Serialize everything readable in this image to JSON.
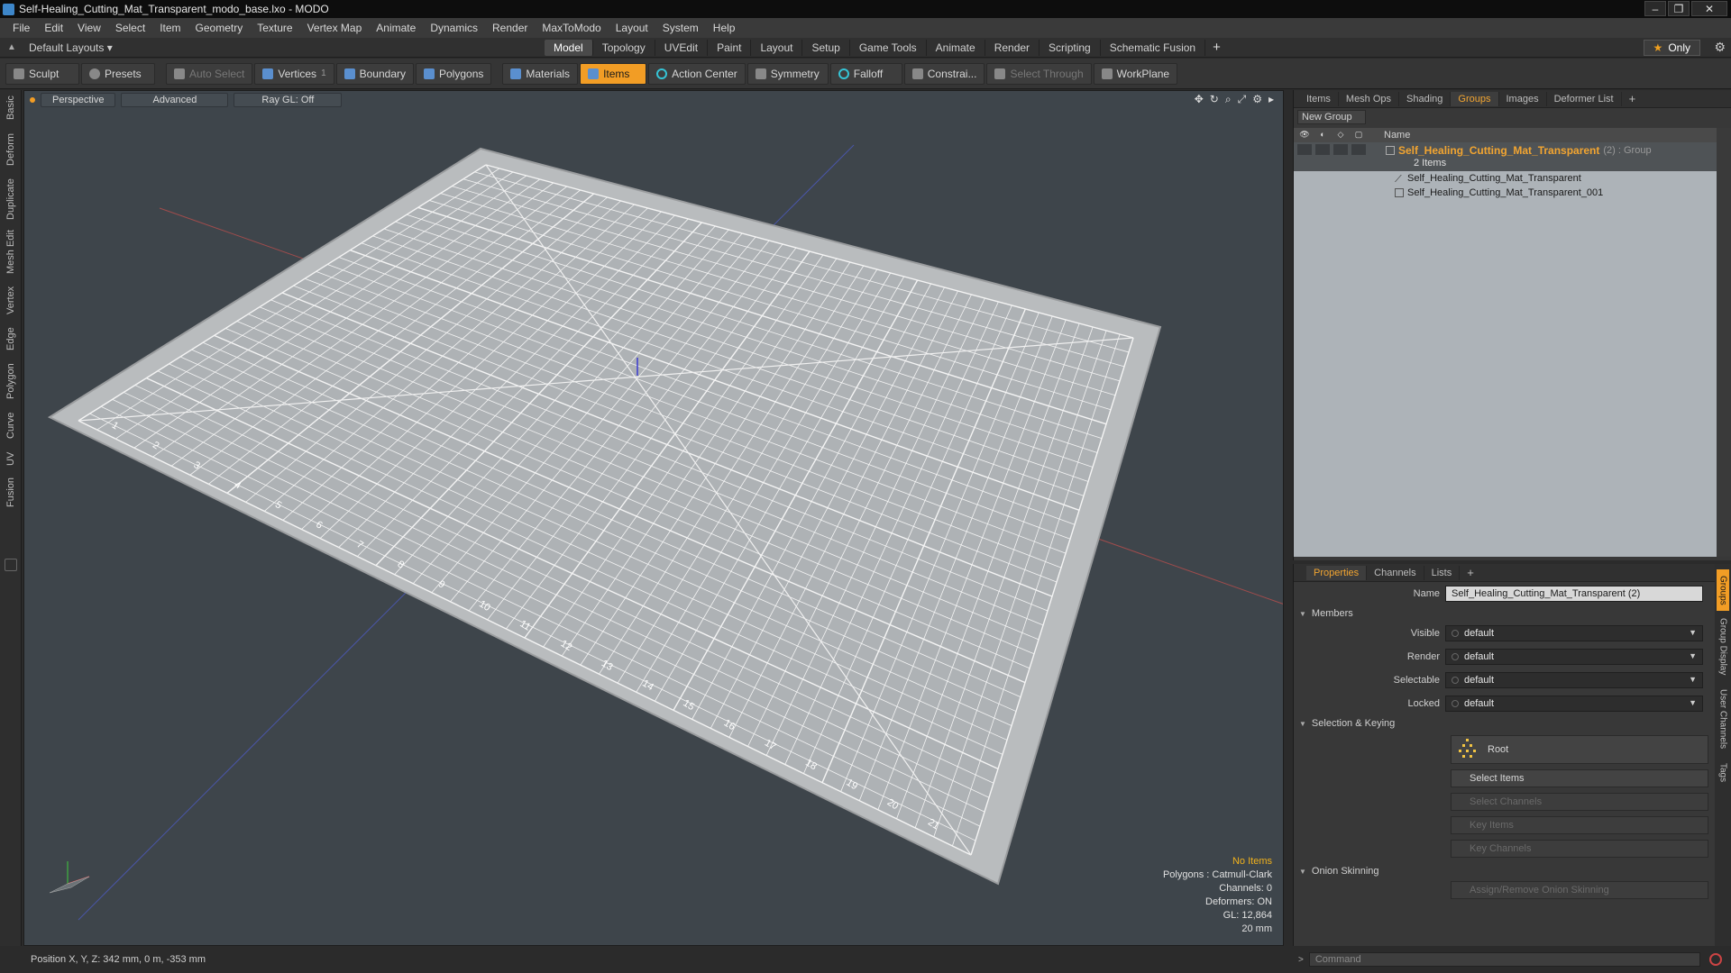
{
  "window": {
    "title": "Self-Healing_Cutting_Mat_Transparent_modo_base.lxo - MODO",
    "minimize": "–",
    "restore": "❐",
    "close": "✕"
  },
  "menu": [
    "File",
    "Edit",
    "View",
    "Select",
    "Item",
    "Geometry",
    "Texture",
    "Vertex Map",
    "Animate",
    "Dynamics",
    "Render",
    "MaxToModo",
    "Layout",
    "System",
    "Help"
  ],
  "layouts": {
    "label": "Default Layouts ▾"
  },
  "tabs": [
    "Model",
    "Topology",
    "UVEdit",
    "Paint",
    "Layout",
    "Setup",
    "Game Tools",
    "Animate",
    "Render",
    "Scripting",
    "Schematic Fusion"
  ],
  "tabs_active": "Model",
  "tabs_plus": "+",
  "only_label": "Only",
  "toolbar": {
    "sculpt": "Sculpt",
    "presets": "Presets",
    "auto_select": "Auto Select",
    "vertices": "Vertices",
    "vertices_count": "1",
    "boundary": "Boundary",
    "polygons": "Polygons",
    "materials": "Materials",
    "items": "Items",
    "action_center": "Action Center",
    "symmetry": "Symmetry",
    "falloff": "Falloff",
    "constraints": "Constrai...",
    "select_through": "Select Through",
    "workplane": "WorkPlane"
  },
  "left_tabs": [
    "Basic",
    "Deform",
    "Duplicate",
    "Mesh Edit",
    "Vertex",
    "Edge",
    "Polygon",
    "Curve",
    "UV",
    "Fusion"
  ],
  "viewport": {
    "view": "Perspective",
    "shading": "Advanced",
    "raygl": "Ray GL: Off",
    "info": {
      "selection": "No Items",
      "polygons": "Polygons : Catmull-Clark",
      "channels": "Channels: 0",
      "deformers": "Deformers: ON",
      "gl": "GL: 12,864",
      "grid": "20 mm"
    },
    "ruler_labels": [
      "1",
      "2",
      "3",
      "4",
      "5",
      "6",
      "7",
      "8",
      "9",
      "10",
      "11",
      "12",
      "13",
      "14",
      "15",
      "16",
      "17",
      "18",
      "19",
      "20",
      "21"
    ]
  },
  "status": {
    "position": "Position X, Y, Z:  342 mm, 0 m, -353 mm"
  },
  "groups_panel": {
    "tabs": [
      "Items",
      "Mesh Ops",
      "Shading",
      "Groups",
      "Images",
      "Deformer List"
    ],
    "active_tab": "Groups",
    "new_group": "New Group",
    "name_header": "Name",
    "group": {
      "name": "Self_Healing_Cutting_Mat_Transparent",
      "suffix": "(2) : Group",
      "count": "2 Items"
    },
    "items": [
      "Self_Healing_Cutting_Mat_Transparent",
      "Self_Healing_Cutting_Mat_Transparent_001"
    ]
  },
  "properties": {
    "tabs": [
      "Properties",
      "Channels",
      "Lists"
    ],
    "active_tab": "Properties",
    "name_label": "Name",
    "name_value": "Self_Healing_Cutting_Mat_Transparent (2)",
    "members_header": "Members",
    "fields": [
      {
        "label": "Visible",
        "value": "default"
      },
      {
        "label": "Render",
        "value": "default"
      },
      {
        "label": "Selectable",
        "value": "default"
      },
      {
        "label": "Locked",
        "value": "default"
      }
    ],
    "selection_header": "Selection & Keying",
    "root": "Root",
    "select_items": "Select Items",
    "select_channels": "Select Channels",
    "key_items": "Key Items",
    "key_channels": "Key Channels",
    "onion_header": "Onion Skinning",
    "onion_button": "Assign/Remove Onion Skinning",
    "side_tabs": [
      "Groups",
      "Group Display",
      "User Channels",
      "Tags"
    ]
  },
  "command": {
    "placeholder": "Command"
  },
  "colors": {
    "accent": "#f29d25",
    "viewport_bg": "#3e454b",
    "group_highlight": "#f2a531"
  }
}
